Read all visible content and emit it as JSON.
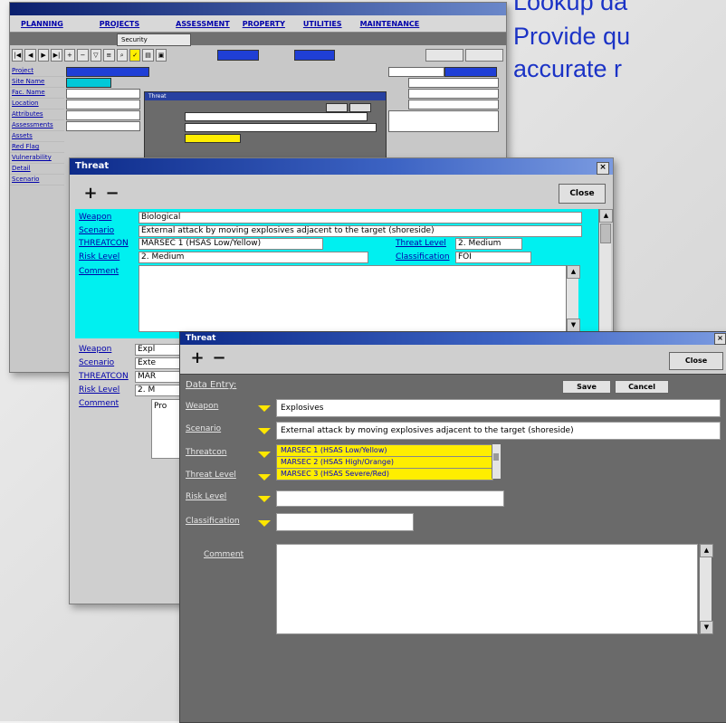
{
  "caption": {
    "line1": "Lookup da",
    "line2": "Provide qu",
    "line3": "accurate r"
  },
  "win1": {
    "nav": [
      "PLANNING",
      "PROJECTS",
      "ASSESSMENT",
      "PROPERTY",
      "UTILITIES",
      "MAINTENANCE"
    ],
    "tab": "Security",
    "side_items": [
      "Project",
      "Site Name",
      "Fac. Name",
      "Location",
      "Attributes",
      "Assessments",
      "Assets",
      "Red Flag",
      "Vulnerability",
      "Detail",
      "Scenario"
    ],
    "popup_title": "Threat"
  },
  "win2": {
    "title": "Threat",
    "close_label": "Close",
    "weapon_label": "Weapon",
    "weapon_value": "Biological",
    "scenario_label": "Scenario",
    "scenario_value": "External attack by moving explosives adjacent to the target (shoreside)",
    "threatcon_label": "THREATCON",
    "threatcon_value": "MARSEC 1 (HSAS Low/Yellow)",
    "threat_level_label": "Threat Level",
    "threat_level_value": "2. Medium",
    "risk_level_label": "Risk Level",
    "risk_level_value": "2. Medium",
    "classification_label": "Classification",
    "classification_value": "FOI",
    "comment_label": "Comment",
    "r2_weapon_label": "Weapon",
    "r2_weapon_value": "Expl",
    "r2_scenario_label": "Scenario",
    "r2_scenario_value": "Exte",
    "r2_threatcon_label": "THREATCON",
    "r2_threatcon_value": "MAR",
    "r2_risk_label": "Risk Level",
    "r2_risk_value": "2. M",
    "r2_comment_label": "Comment",
    "r2_comment_value": "Pro"
  },
  "win3": {
    "title": "Threat",
    "close_label": "Close",
    "data_entry_label": "Data Entry:",
    "save_label": "Save",
    "cancel_label": "Cancel",
    "weapon_label": "Weapon",
    "weapon_value": "Explosives",
    "scenario_label": "Scenario",
    "scenario_value": "External attack by moving explosives adjacent to the target (shoreside)",
    "threatcon_label": "Threatcon",
    "threat_level_label": "Threat Level",
    "risk_level_label": "Risk Level",
    "classification_label": "Classification",
    "comment_label": "Comment",
    "options": [
      "MARSEC 1 (HSAS Low/Yellow)",
      "MARSEC 2 (HSAS High/Orange)",
      "MARSEC 3 (HSAS Severe/Red)"
    ]
  },
  "colors": {
    "caption": "#1b33c6",
    "cyan_panel": "#00f0f0",
    "highlight": "#ffee00",
    "title_bar": "#0d2b8a"
  }
}
